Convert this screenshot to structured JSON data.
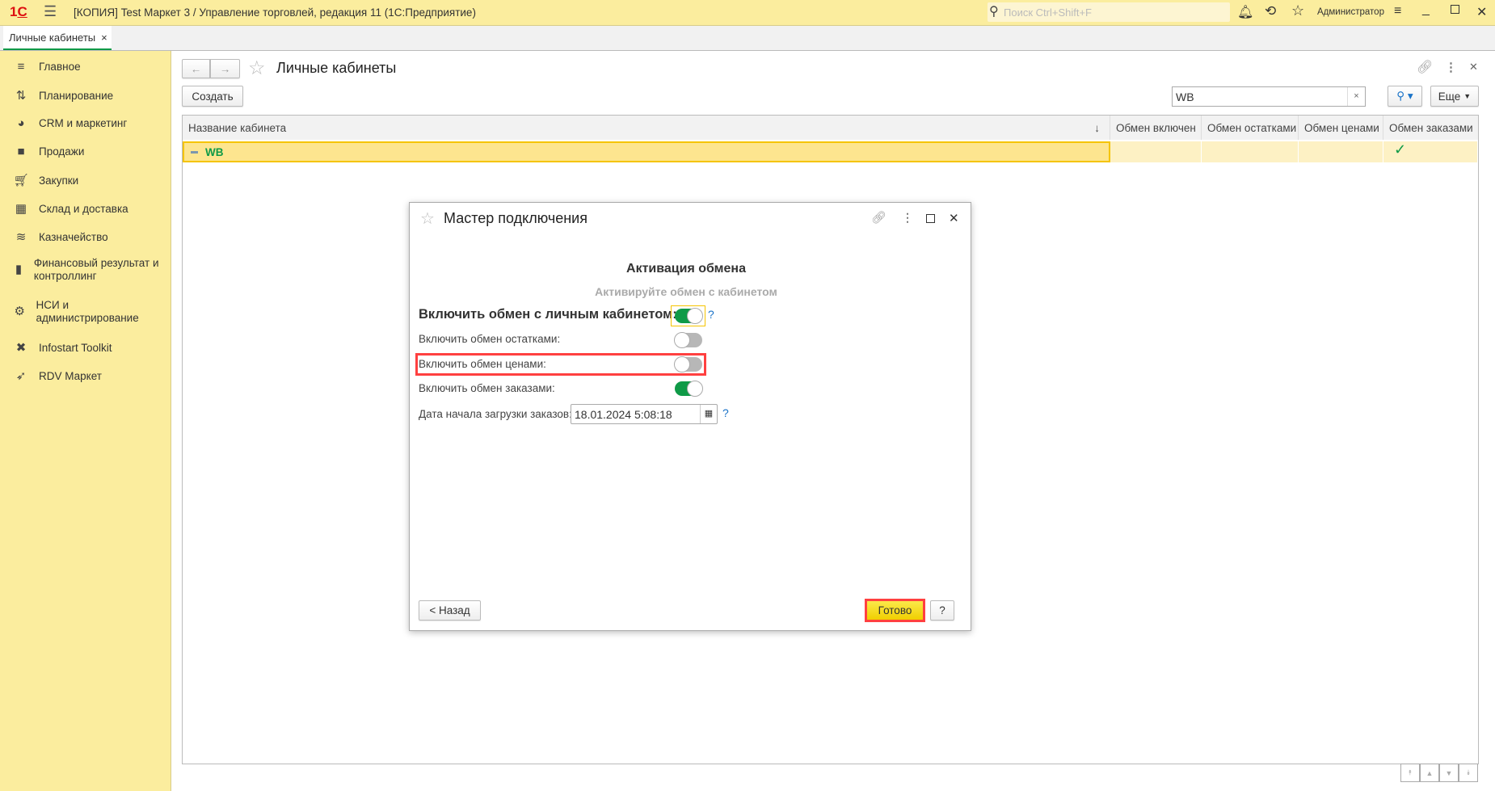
{
  "app": {
    "logo": "1С",
    "title": "[КОПИЯ] Test Маркет 3 / Управление торговлей, редакция 11  (1С:Предприятие)",
    "search_placeholder": "Поиск Ctrl+Shift+F",
    "user": "Администратор"
  },
  "tabs": [
    {
      "label": "Личные кабинеты",
      "close": "×"
    }
  ],
  "sidebar": {
    "items": [
      {
        "label": "Главное",
        "icon": "menu-icon"
      },
      {
        "label": "Планирование",
        "icon": "planning-icon"
      },
      {
        "label": "CRM и маркетинг",
        "icon": "pie-chart-icon"
      },
      {
        "label": "Продажи",
        "icon": "bag-icon"
      },
      {
        "label": "Закупки",
        "icon": "cart-icon"
      },
      {
        "label": "Склад и доставка",
        "icon": "warehouse-icon"
      },
      {
        "label": "Казначейство",
        "icon": "coins-icon"
      },
      {
        "label": "Финансовый результат и контроллинг",
        "icon": "bar-chart-icon"
      },
      {
        "label": "НСИ и администрирование",
        "icon": "gear-icon"
      },
      {
        "label": "Infostart Toolkit",
        "icon": "tools-icon"
      },
      {
        "label": "RDV Маркет",
        "icon": "rocket-icon"
      }
    ]
  },
  "form": {
    "title": "Личные кабинеты",
    "create_label": "Создать",
    "search_value": "WB",
    "more_label": "Еще",
    "columns": [
      "Название кабинета",
      "Обмен включен",
      "Обмен остатками",
      "Обмен ценами",
      "Обмен заказами"
    ],
    "rows": [
      {
        "name": "WB",
        "exchange_enabled": false,
        "stock": false,
        "prices": false,
        "orders": true
      }
    ]
  },
  "dialog": {
    "title": "Мастер подключения",
    "heading": "Активация обмена",
    "subheading": "Активируйте обмен с кабинетом",
    "main_toggle_label": "Включить обмен с личным кабинетом:",
    "main_toggle": true,
    "stock_label": "Включить обмен остатками:",
    "stock": false,
    "prices_label": "Включить обмен ценами:",
    "prices": false,
    "orders_label": "Включить обмен заказами:",
    "orders": true,
    "date_label": "Дата начала загрузки заказов:",
    "date_value": "18.01.2024  5:08:18",
    "help": "?",
    "back_label": "< Назад",
    "done_label": "Готово",
    "help_button": "?"
  },
  "colors": {
    "accent": "#fbed9e",
    "green": "#0f9a47",
    "highlight": "#ff4040",
    "done": "#f5d800"
  }
}
